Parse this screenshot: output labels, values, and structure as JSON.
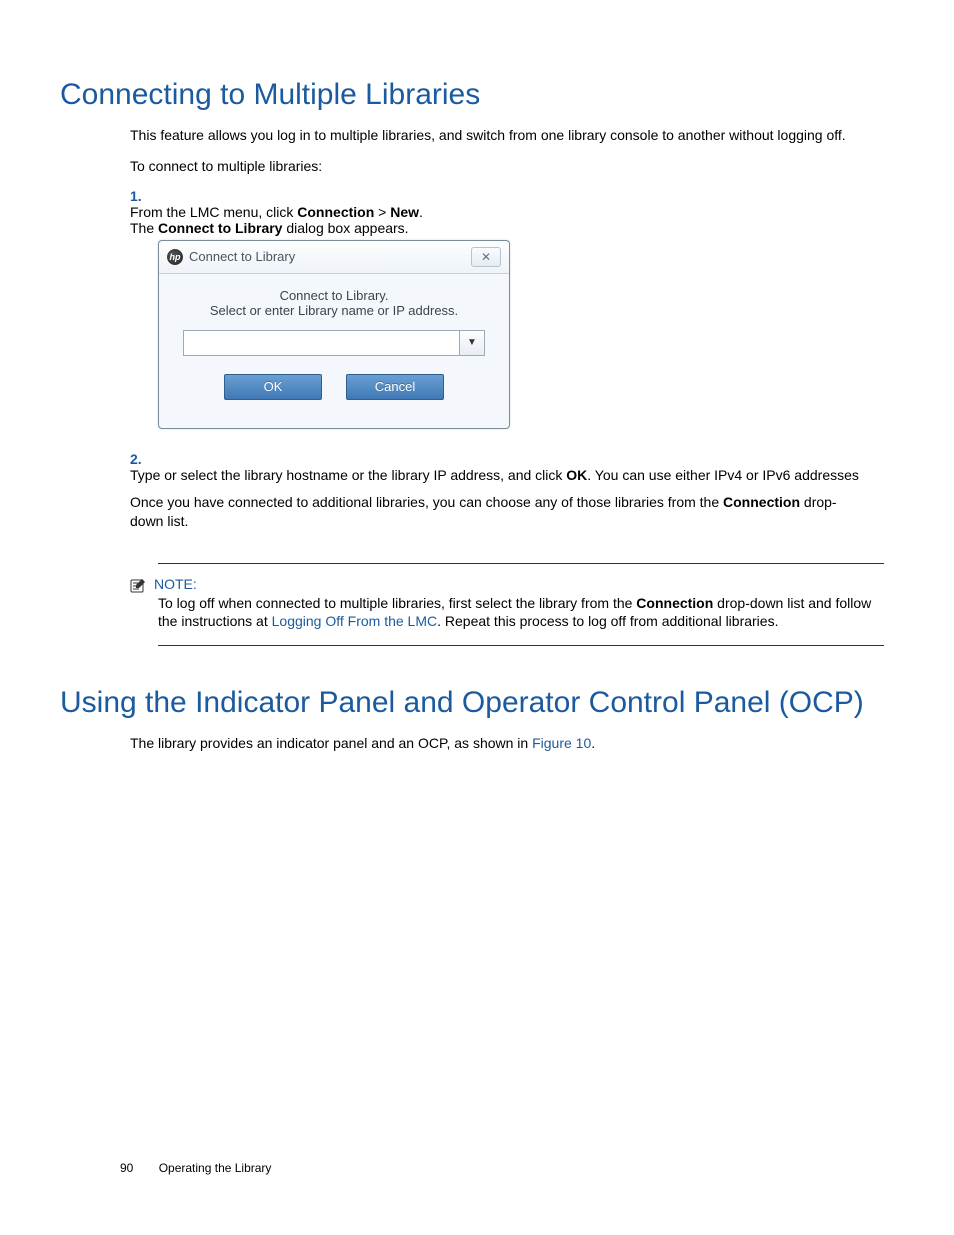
{
  "headings": {
    "h1_connecting": "Connecting to Multiple Libraries",
    "h1_ocp": "Using the Indicator Panel and Operator Control Panel (OCP)"
  },
  "intro": {
    "p1": "This feature allows you log in to multiple libraries, and switch from one library console to another without logging off.",
    "p2": "To connect to multiple libraries:"
  },
  "steps": {
    "s1": {
      "num": "1.",
      "seg_a": "From the LMC menu, click ",
      "bold_a": "Connection",
      "seg_b": " > ",
      "bold_b": "New",
      "seg_c": ".",
      "line2_a": "The ",
      "line2_bold": "Connect to Library",
      "line2_b": " dialog box appears."
    },
    "s2": {
      "num": "2.",
      "seg_a": "Type or select the library hostname or the library IP address, and click ",
      "bold_a": "OK",
      "seg_b": ". You can use either IPv4 or IPv6 addresses",
      "p2_a": "Once you have connected to additional libraries, you can choose any of those libraries from the ",
      "p2_bold": "Connection",
      "p2_b": " drop-down list."
    }
  },
  "dialog": {
    "title": "Connect to Library",
    "line1": "Connect to Library.",
    "line2": "Select or enter Library name or IP address.",
    "ok": "OK",
    "cancel": "Cancel",
    "hp": "hp"
  },
  "note": {
    "label": "NOTE:",
    "seg_a": "To log off when connected to multiple libraries, first select the library from the ",
    "bold_a": "Connection",
    "seg_b": " drop-down list and follow the instructions at ",
    "link": "Logging Off From the LMC",
    "seg_c": ". Repeat this process to log off from additional libraries."
  },
  "ocp": {
    "p1_a": "The library provides an indicator panel and an OCP, as shown in ",
    "p1_link": "Figure 10",
    "p1_b": "."
  },
  "footer": {
    "page": "90",
    "section": "Operating the Library"
  }
}
